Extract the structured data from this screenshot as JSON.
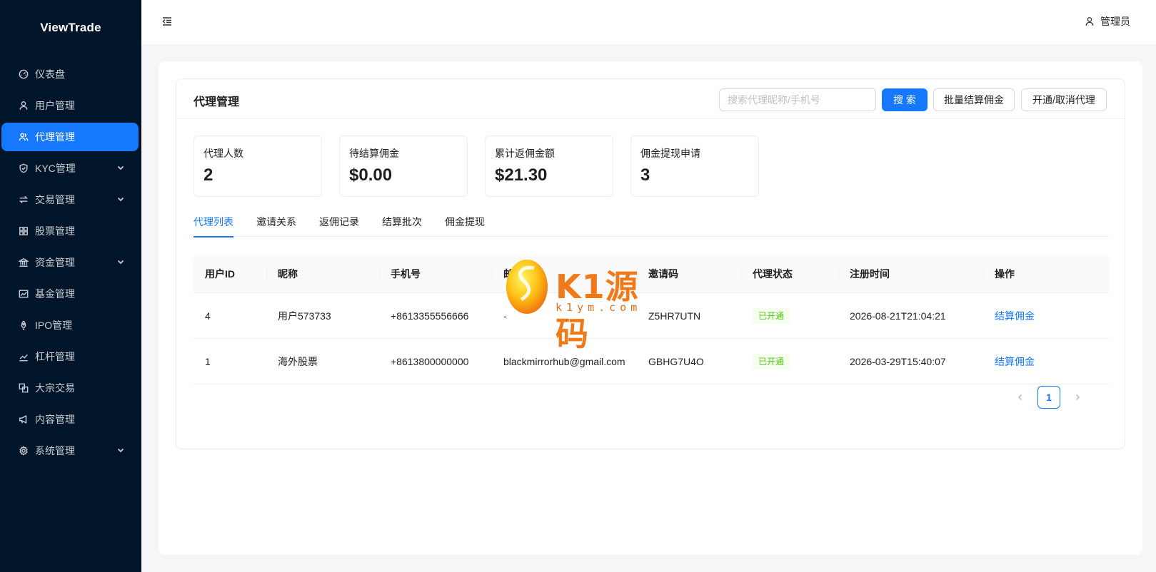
{
  "app": {
    "logo": "ViewTrade"
  },
  "sidebar": {
    "items": [
      {
        "label": "仪表盘",
        "icon": "dashboard-icon",
        "active": false,
        "expandable": false
      },
      {
        "label": "用户管理",
        "icon": "user-icon",
        "active": false,
        "expandable": false
      },
      {
        "label": "代理管理",
        "icon": "team-icon",
        "active": true,
        "expandable": false
      },
      {
        "label": "KYC管理",
        "icon": "shield-check-icon",
        "active": false,
        "expandable": true
      },
      {
        "label": "交易管理",
        "icon": "swap-icon",
        "active": false,
        "expandable": true
      },
      {
        "label": "股票管理",
        "icon": "grid-icon",
        "active": false,
        "expandable": false
      },
      {
        "label": "资金管理",
        "icon": "bank-icon",
        "active": false,
        "expandable": true
      },
      {
        "label": "基金管理",
        "icon": "area-chart-icon",
        "active": false,
        "expandable": false
      },
      {
        "label": "IPO管理",
        "icon": "rocket-icon",
        "active": false,
        "expandable": false
      },
      {
        "label": "杠杆管理",
        "icon": "line-chart-icon",
        "active": false,
        "expandable": false
      },
      {
        "label": "大宗交易",
        "icon": "block-icon",
        "active": false,
        "expandable": false
      },
      {
        "label": "内容管理",
        "icon": "notification-icon",
        "active": false,
        "expandable": false
      },
      {
        "label": "系统管理",
        "icon": "setting-icon",
        "active": false,
        "expandable": true
      }
    ]
  },
  "header": {
    "user_label": "管理员"
  },
  "page": {
    "title": "代理管理",
    "search_placeholder": "搜索代理昵称/手机号",
    "search_button": "搜 索",
    "batch_button": "批量结算佣金",
    "toggle_button": "开通/取消代理"
  },
  "stats": [
    {
      "label": "代理人数",
      "value": "2"
    },
    {
      "label": "待结算佣金",
      "value": "$0.00"
    },
    {
      "label": "累计返佣金额",
      "value": "$21.30"
    },
    {
      "label": "佣金提现申请",
      "value": "3"
    }
  ],
  "tabs": [
    "代理列表",
    "邀请关系",
    "返佣记录",
    "结算批次",
    "佣金提现"
  ],
  "active_tab": 0,
  "table": {
    "columns": [
      "用户ID",
      "昵称",
      "手机号",
      "邮",
      "邀请码",
      "代理状态",
      "注册时间",
      "操作"
    ],
    "rows": [
      {
        "id": "4",
        "nickname": "用户573733",
        "phone": "+8613355556666",
        "email": "-",
        "invite_code": "Z5HR7UTN",
        "status": "已开通",
        "registered": "2026-08-21T21:04:21",
        "action": "结算佣金"
      },
      {
        "id": "1",
        "nickname": "海外股票",
        "phone": "+8613800000000",
        "email": "blackmirrorhub@gmail.com",
        "invite_code": "GBHG7U4O",
        "status": "已开通",
        "registered": "2026-03-29T15:40:07",
        "action": "结算佣金"
      }
    ]
  },
  "pagination": {
    "current": "1"
  },
  "watermark": {
    "title": "K1源码",
    "subtitle": "k1ym.com"
  },
  "colors": {
    "sidebar_bg": "#001529",
    "primary": "#1677ff",
    "success": "#52c41a"
  }
}
